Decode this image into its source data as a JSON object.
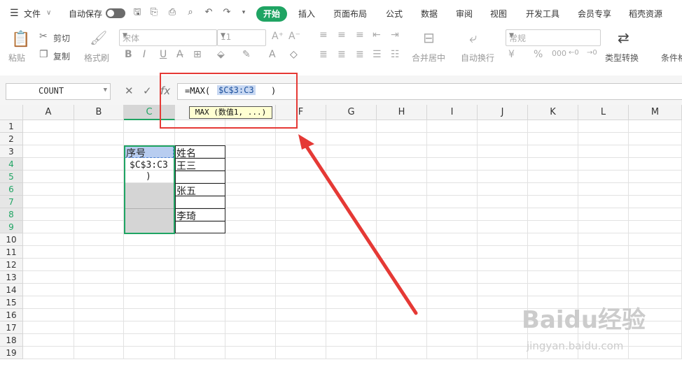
{
  "menubar": {
    "file_label": "文件",
    "autosave_label": "自动保存",
    "tabs": [
      "开始",
      "插入",
      "页面布局",
      "公式",
      "数据",
      "审阅",
      "视图",
      "开发工具",
      "会员专享",
      "稻壳资源"
    ]
  },
  "ribbon": {
    "paste_label": "粘贴",
    "cut_label": "剪切",
    "copy_label": "复制",
    "format_painter_label": "格式刷",
    "font_name": "宋体",
    "font_size": "11",
    "merge_label": "合并居中",
    "wrap_label": "自动换行",
    "number_format": "常规",
    "type_convert_label": "类型转换",
    "cond_format_label": "条件格"
  },
  "formula_bar": {
    "name_box": "COUNT",
    "fx_label": "fx",
    "formula_prefix": "=MAX(",
    "formula_ref": "$C$3:C3",
    "formula_suffix": ")",
    "tooltip": "MAX (数值1, ...)"
  },
  "grid": {
    "columns": [
      "A",
      "B",
      "C",
      "D",
      "E",
      "F",
      "G",
      "H",
      "I",
      "J",
      "K",
      "L",
      "M"
    ],
    "rows": [
      "1",
      "2",
      "3",
      "4",
      "5",
      "6",
      "7",
      "8",
      "9",
      "10",
      "11",
      "12",
      "13",
      "14",
      "15",
      "16",
      "17",
      "18",
      "19"
    ],
    "selected_column": "C",
    "cells": {
      "C3": "序号",
      "C4": "$C$3:C3",
      "C5": ")",
      "D3": "姓名",
      "D4": "王三",
      "D6": "张五",
      "D8": "李琦"
    }
  },
  "watermark": {
    "brand": "Baidu经验",
    "url": "jingyan.baidu.com"
  },
  "colors": {
    "accent": "#1fa463",
    "annotation": "#e53935",
    "selection_fill": "#b8cdf0"
  }
}
